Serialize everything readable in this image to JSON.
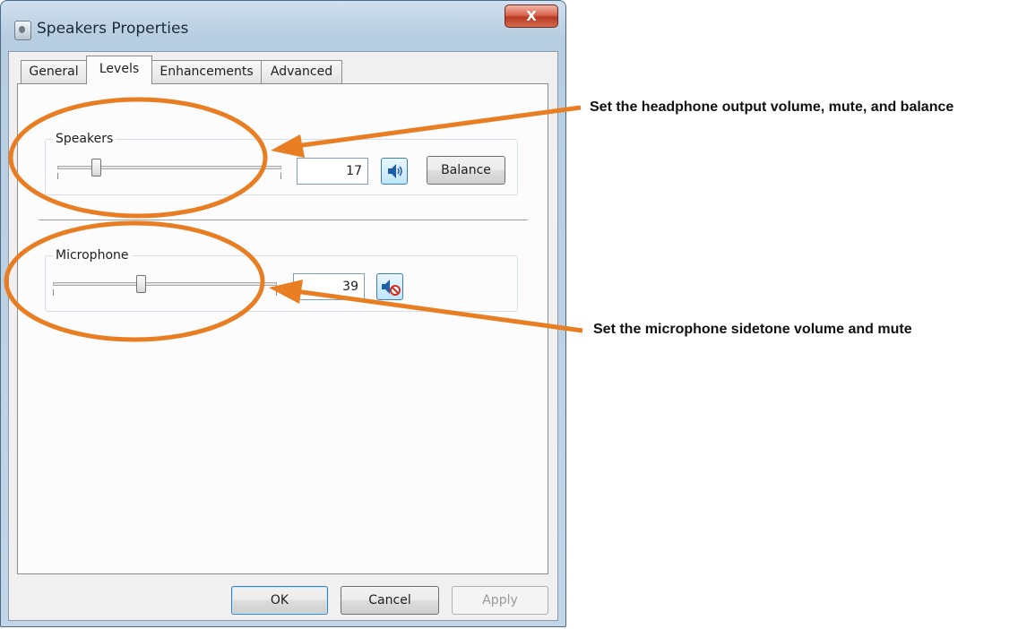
{
  "window": {
    "title": "Speakers Properties",
    "close_glyph": "X"
  },
  "tabs": [
    {
      "label": "General",
      "active": false
    },
    {
      "label": "Levels",
      "active": true
    },
    {
      "label": "Enhancements",
      "active": false
    },
    {
      "label": "Advanced",
      "active": false
    }
  ],
  "speakers": {
    "group_label": "Speakers",
    "value": "17",
    "level_percent": 17,
    "mute_icon": "speaker-volume-icon",
    "balance_label": "Balance"
  },
  "microphone": {
    "group_label": "Microphone",
    "value": "39",
    "level_percent": 39,
    "mute_icon": "speaker-muted-icon"
  },
  "buttons": {
    "ok": "OK",
    "cancel": "Cancel",
    "apply": "Apply"
  },
  "annotations": {
    "headphone_note": "Set the headphone output volume, mute, and balance",
    "microphone_note": "Set the microphone sidetone volume and mute",
    "color": "#e87d22"
  },
  "colors": {
    "annotation_orange": "#e87d22",
    "close_button_red": "#c9452e",
    "focus_blue": "#3c7fb1"
  }
}
